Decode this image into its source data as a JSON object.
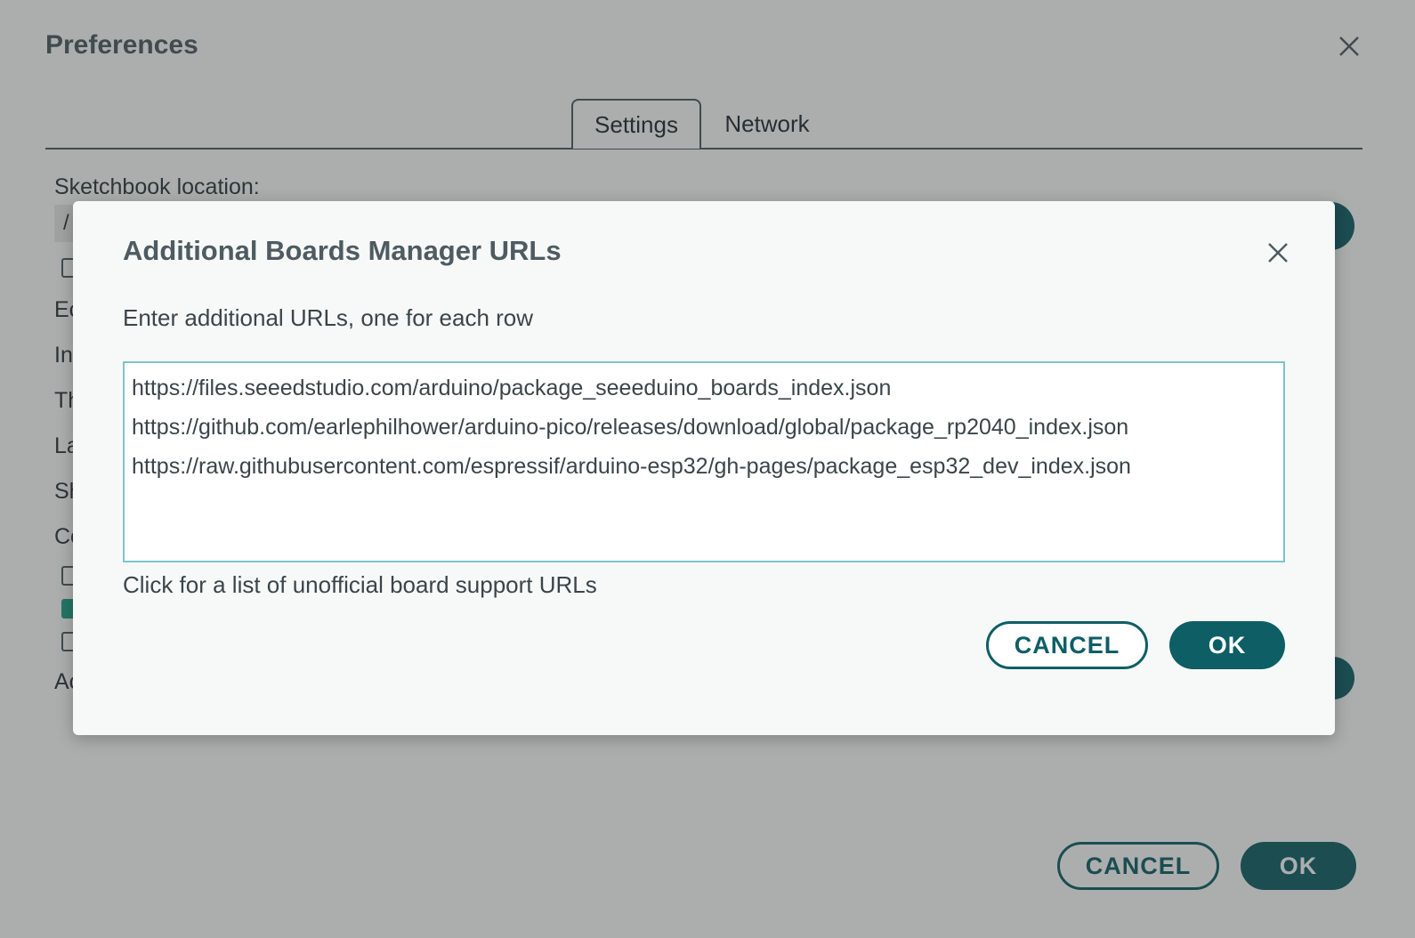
{
  "preferences": {
    "title": "Preferences",
    "tabs": [
      {
        "label": "Settings",
        "active": true
      },
      {
        "label": "Network",
        "active": false
      }
    ],
    "sketchbook_label": "Sketchbook location:",
    "sketchbook_value": "/",
    "partial_labels": [
      "Ec",
      "In",
      "Th",
      "La",
      "Sh",
      "Co",
      "Ac"
    ],
    "cancel_label": "CANCEL",
    "ok_label": "OK"
  },
  "modal": {
    "title": "Additional Boards Manager URLs",
    "description": "Enter additional URLs, one for each row",
    "urls": [
      "https://files.seeedstudio.com/arduino/package_seeeduino_boards_index.json",
      "https://github.com/earlephilhower/arduino-pico/releases/download/global/package_rp2040_index.json",
      "https://raw.githubusercontent.com/espressif/arduino-esp32/gh-pages/package_esp32_dev_index.json"
    ],
    "link_text": "Click for a list of unofficial board support URLs",
    "cancel_label": "CANCEL",
    "ok_label": "OK"
  },
  "colors": {
    "primary": "#0e5e65",
    "text_dark": "#4e5b61",
    "textarea_border": "#7fc4c8",
    "checkbox_checked": "#1da086"
  },
  "icons": {
    "close": "close-icon"
  }
}
